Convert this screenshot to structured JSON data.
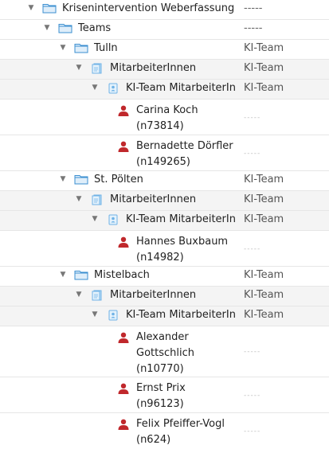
{
  "tree": {
    "root": {
      "label": "Krisenintervention Weberfassung",
      "value": "-----"
    },
    "teams": {
      "label": "Teams",
      "value": "-----"
    },
    "groups": [
      {
        "location": {
          "label": "Tulln",
          "value": "KI-Team"
        },
        "staff": {
          "label": "MitarbeiterInnen",
          "value": "KI-Team"
        },
        "role": {
          "label": "KI-Team MitarbeiterIn",
          "value": "KI-Team"
        },
        "people": [
          {
            "name": "Carina Koch",
            "id": "(n73814)",
            "value": "-----"
          },
          {
            "name": "Bernadette Dörfler",
            "id": "(n149265)",
            "value": "-----"
          }
        ]
      },
      {
        "location": {
          "label": "St. Pölten",
          "value": "KI-Team"
        },
        "staff": {
          "label": "MitarbeiterInnen",
          "value": "KI-Team"
        },
        "role": {
          "label": "KI-Team MitarbeiterIn",
          "value": "KI-Team"
        },
        "people": [
          {
            "name": "Hannes Buxbaum",
            "id": "(n14982)",
            "value": "-----"
          }
        ]
      },
      {
        "location": {
          "label": "Mistelbach",
          "value": "KI-Team"
        },
        "staff": {
          "label": "MitarbeiterInnen",
          "value": "KI-Team"
        },
        "role": {
          "label": "KI-Team MitarbeiterIn",
          "value": "KI-Team"
        },
        "people": [
          {
            "name_lines": [
              "Alexander",
              "Gottschlich"
            ],
            "id": "(n10770)",
            "value": "-----"
          },
          {
            "name": "Ernst Prix",
            "id": "(n96123)",
            "value": "-----"
          },
          {
            "name": "Felix Pfeiffer-Vogl",
            "id": "(n624)",
            "value": "-----"
          }
        ]
      }
    ]
  },
  "icons": {
    "toggle": "triangle-down",
    "folder": "folder-icon",
    "staff": "document-icon",
    "role": "badge-icon",
    "person": "person-icon"
  },
  "colors": {
    "folder": "#3b8fd0",
    "person": "#c0282c",
    "doc": "#6fb2e6"
  }
}
